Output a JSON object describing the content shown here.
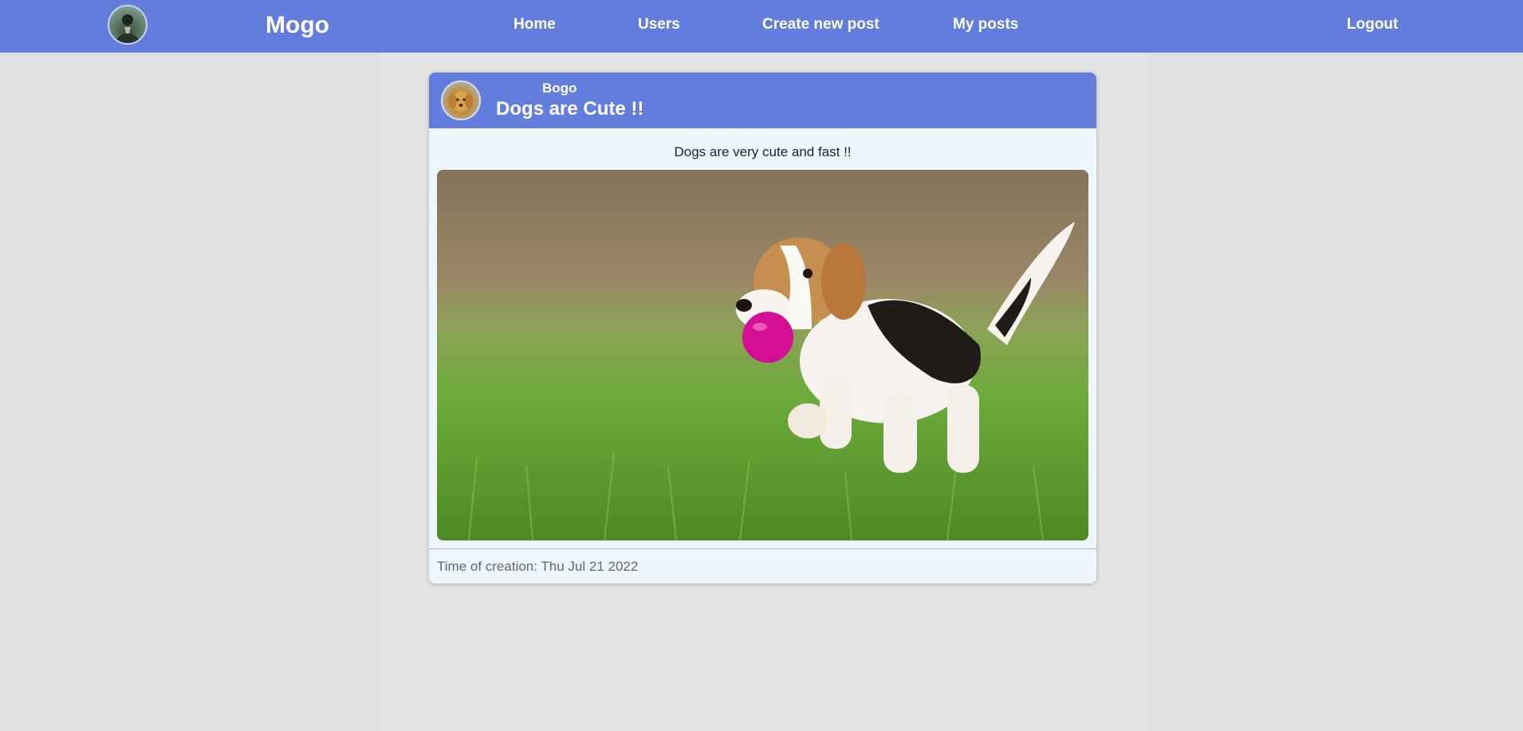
{
  "navbar": {
    "brand": "Mogo",
    "links": {
      "home": "Home",
      "users": "Users",
      "create": "Create new post",
      "my_posts": "My posts",
      "logout": "Logout"
    }
  },
  "post": {
    "author": "Bogo",
    "title": "Dogs are Cute !!",
    "description": "Dogs are very cute and fast !!",
    "time_label": "Time of creation: Thu Jul 21 2022"
  },
  "colors": {
    "primary": "#627ddb",
    "page_background": "#e0e0e0",
    "card_background": "#eef6fd"
  }
}
